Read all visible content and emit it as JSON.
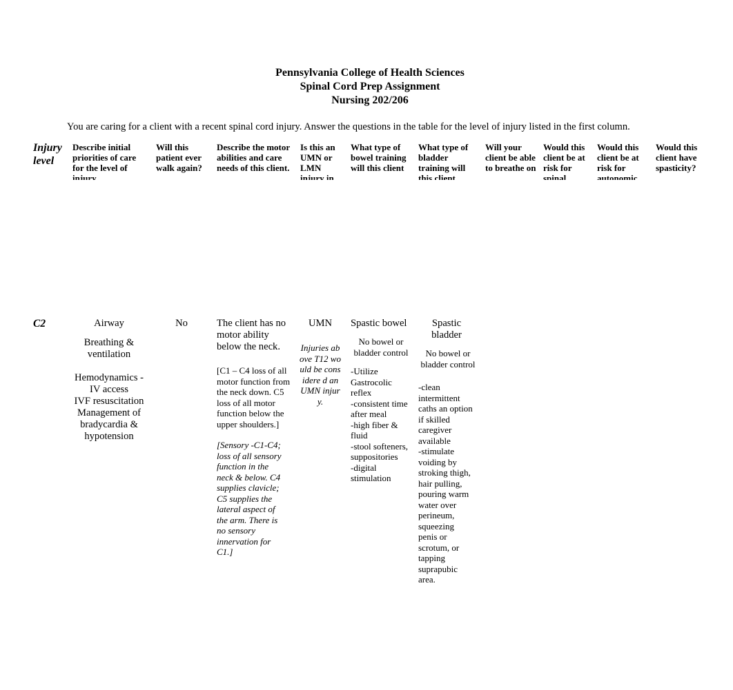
{
  "header": {
    "institution": "Pennsylvania College of Health Sciences",
    "assignment": "Spinal Cord Prep Assignment",
    "course": "Nursing 202/206"
  },
  "intro": "You are caring for a client with a recent spinal cord injury. Answer the questions in the table for the level of injury listed in the first column.",
  "table": {
    "columns": [
      "Injury level",
      "Describe initial priorities of care for the level of injury.",
      "Will this patient ever walk again?",
      "Describe the motor abilities and care needs of this client.",
      "Is this an UMN or LMN injury in",
      "What type of bowel training will this client",
      "What type of bladder training will this client",
      "Will your client be able to breathe on",
      "Would this client be at risk for spinal",
      "Would this client be at risk for autonomic",
      "Would this client have spasticity?"
    ],
    "rows": [
      {
        "level": "C2",
        "priorities": {
          "airway": "Airway",
          "breathing": "Breathing & ventilation",
          "hemo_1": "Hemodynamics -",
          "hemo_2": "IV access",
          "hemo_3": "IVF resuscitation",
          "hemo_4": "Management of bradycardia & hypotension"
        },
        "walk_again": "No",
        "motor": {
          "summary": "The client has no motor ability below the neck.",
          "detail": "[C1 – C4 loss of all motor function from the neck down. C5 loss of all motor function below the upper shoulders.]",
          "sensory": "[Sensory -C1-C4; loss of all sensory function in the neck & below. C4 supplies clavicle; C5 supplies the lateral aspect of the arm. There is no sensory innervation for C1.]"
        },
        "umn_lmn": {
          "answer": "UMN",
          "note": "Injuries above T12 would be considere d an UMN injury."
        },
        "bowel": {
          "type": "Spastic bowel",
          "control": "No bowel or bladder control",
          "items": [
            "-Utilize Gastrocolic reflex",
            "-consistent time after meal",
            "-high fiber & fluid",
            "-stool softeners, suppositories",
            "-digital stimulation"
          ]
        },
        "bladder": {
          "type": "Spastic bladder",
          "control": "No bowel or bladder control",
          "items": [
            "-clean intermittent caths an option if skilled caregiver available",
            "-stimulate voiding by stroking thigh, hair pulling, pouring warm water over perineum, squeezing penis or scrotum, or tapping suprapubic area."
          ]
        },
        "breathe": "",
        "spinal_shock": "",
        "autonomic": "",
        "spasticity": ""
      }
    ]
  }
}
